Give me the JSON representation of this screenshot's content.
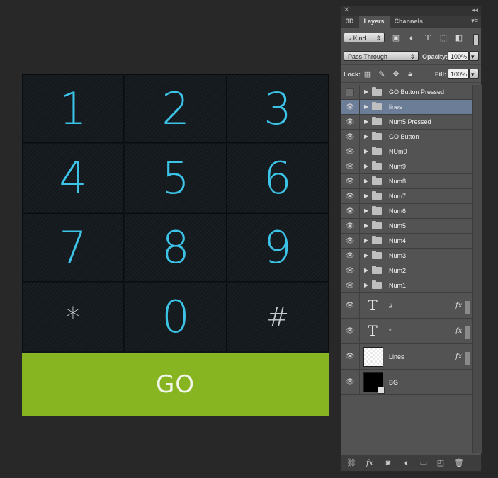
{
  "keypad": {
    "keys": [
      "1",
      "2",
      "3",
      "4",
      "5",
      "6",
      "7",
      "8",
      "9",
      "*",
      "0",
      "#"
    ],
    "go_label": "GO",
    "digit_color": "#3cc3e8",
    "go_color": "#87b421"
  },
  "panel": {
    "tabs": [
      "3D",
      "Layers",
      "Channels"
    ],
    "kind_label": "Kind",
    "blend_mode": "Pass Through",
    "opacity_label": "Opacity:",
    "opacity_value": "100%",
    "lock_label": "Lock:",
    "fill_label": "Fill:",
    "fill_value": "100%",
    "selected_color": "#6c7d98"
  },
  "layers": [
    {
      "name": "GO Button Pressed",
      "type": "group",
      "visible": false
    },
    {
      "name": "lines",
      "type": "group",
      "visible": true,
      "selected": true
    },
    {
      "name": "Num5 Pressed",
      "type": "group",
      "visible": true
    },
    {
      "name": "GO Button",
      "type": "group",
      "visible": true
    },
    {
      "name": "NUm0",
      "type": "group",
      "visible": true
    },
    {
      "name": "Num9",
      "type": "group",
      "visible": true
    },
    {
      "name": "Num8",
      "type": "group",
      "visible": true
    },
    {
      "name": "Num7",
      "type": "group",
      "visible": true
    },
    {
      "name": "Num6",
      "type": "group",
      "visible": true
    },
    {
      "name": "Num5",
      "type": "group",
      "visible": true
    },
    {
      "name": "Num4",
      "type": "group",
      "visible": true
    },
    {
      "name": "Num3",
      "type": "group",
      "visible": true
    },
    {
      "name": "Num2",
      "type": "group",
      "visible": true
    },
    {
      "name": "Num1",
      "type": "group",
      "visible": true
    }
  ],
  "other_layers": [
    {
      "name": "#",
      "type": "text",
      "fx": "fx"
    },
    {
      "name": "*",
      "type": "text",
      "fx": "fx"
    },
    {
      "name": "Lines",
      "type": "pixel",
      "fx": "fx"
    },
    {
      "name": "BG",
      "type": "smart",
      "fx": ""
    }
  ]
}
